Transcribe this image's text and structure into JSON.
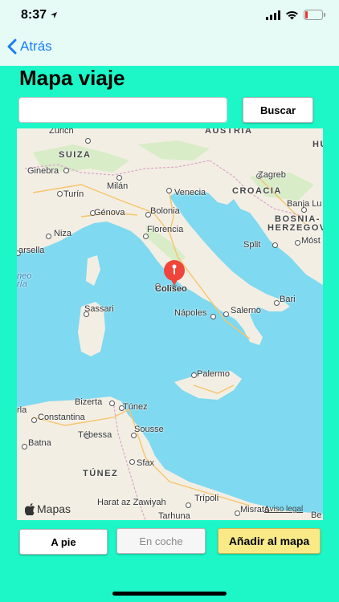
{
  "status_bar": {
    "time": "8:37",
    "icons": [
      "location-arrow-icon",
      "signal-bars-icon",
      "wifi-icon",
      "battery-low-icon"
    ]
  },
  "nav": {
    "back_label": "Atrás"
  },
  "page": {
    "title": "Mapa viaje"
  },
  "search": {
    "value": "",
    "placeholder": "",
    "button_label": "Buscar"
  },
  "map": {
    "pin_label": "Coliseo",
    "countries": {
      "suiza": "SUIZA",
      "croacia": "CROACIA",
      "bosnia": "BOSNIA-",
      "herzegovina": "HERZEGOVI",
      "tunez": "TÚNEZ",
      "austria": "AUSTRIA",
      "hu": "HU"
    },
    "cities": {
      "zurich": "Zúrich",
      "ginebra": "Ginebra",
      "turin": "Turín",
      "milan": "Milán",
      "venecia": "Venecia",
      "zagreb": "Zagreb",
      "banja_luka": "Banja Lu",
      "genova": "Génova",
      "bolonia": "Bolonia",
      "niza": "Niza",
      "florencia": "Florencia",
      "marsella": "arsella",
      "split": "Split",
      "mostar": "Móst",
      "sassari": "Sassari",
      "bari": "Bari",
      "salerno": "Salerno",
      "napoles": "Nápoles",
      "palermo": "Palermo",
      "bizerta": "Bizerta",
      "tunez_city": "Túnez",
      "constantina": "Constantina",
      "tebessa": "Tébessa",
      "sousse": "Sousse",
      "batna": "Batna",
      "sfax": "Sfax",
      "trípoli": "Trípoli",
      "harat": "Harat az Zawiyah",
      "tarhuna": "Tarhuna",
      "misrata": "Misrata",
      "be": "Be",
      "ria": "ría",
      "algarve_left": "rla",
      "lago": "neo"
    },
    "attribution": "Mapas",
    "legal": "Aviso legal"
  },
  "actions": {
    "walk_label": "A pie",
    "car_label": "En coche",
    "add_label": "Añadir al mapa"
  },
  "colors": {
    "background": "#1df7c7",
    "topbar": "#e6fbf5",
    "link": "#1a7ef5",
    "add_button": "#f9ea87",
    "sea": "#7fd9f0",
    "land": "#f3eee3",
    "pin": "#f0453a"
  }
}
